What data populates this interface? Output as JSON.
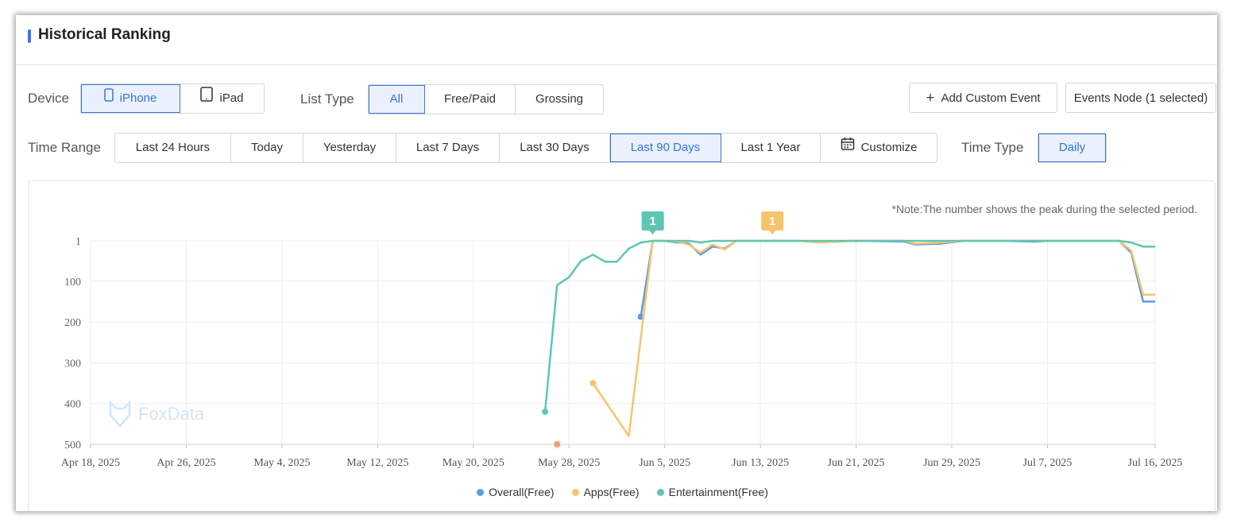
{
  "header": {
    "title": "Historical Ranking"
  },
  "device": {
    "label": "Device",
    "options": [
      {
        "label": "iPhone",
        "icon": "iphone-icon",
        "active": true
      },
      {
        "label": "iPad",
        "icon": "ipad-icon",
        "active": false
      }
    ]
  },
  "list_type": {
    "label": "List Type",
    "options": [
      {
        "label": "All",
        "active": true
      },
      {
        "label": "Free/Paid",
        "active": false
      },
      {
        "label": "Grossing",
        "active": false
      }
    ]
  },
  "actions": {
    "add_event_label": "Add Custom Event",
    "events_node_label": "Events Node (1 selected)"
  },
  "time_range": {
    "label": "Time Range",
    "options": [
      "Last 24 Hours",
      "Today",
      "Yesterday",
      "Last 7 Days",
      "Last 30 Days",
      "Last 90 Days",
      "Last 1 Year",
      "Customize"
    ],
    "active": "Last 90 Days"
  },
  "time_type": {
    "label": "Time Type",
    "option": "Daily"
  },
  "chart": {
    "note": "*Note:The number shows the peak during the selected period.",
    "watermark": "FoxData"
  },
  "colors": {
    "overall": "#5b9be8",
    "apps": "#f7c46c",
    "entertainment": "#5ec6b2",
    "accent": "#3b73d9"
  },
  "chart_data": {
    "type": "line",
    "y_reversed": true,
    "ylim": [
      1,
      500
    ],
    "yticks": [
      1,
      100,
      200,
      300,
      400,
      500
    ],
    "xlim": [
      "2025-04-18",
      "2025-07-16"
    ],
    "xticks": [
      "Apr 18, 2025",
      "Apr 26, 2025",
      "May 4, 2025",
      "May 12, 2025",
      "May 20, 2025",
      "May 28, 2025",
      "Jun 5, 2025",
      "Jun 13, 2025",
      "Jun 21, 2025",
      "Jun 29, 2025",
      "Jul 7, 2025",
      "Jul 16, 2025"
    ],
    "legend_position": "bottom",
    "series": [
      {
        "name": "Overall(Free)",
        "color": "#5b9be8",
        "points": [
          [
            "2025-06-03",
            187
          ],
          [
            "2025-06-04",
            1
          ],
          [
            "2025-06-05",
            1
          ],
          [
            "2025-06-06",
            5
          ],
          [
            "2025-06-07",
            7
          ],
          [
            "2025-06-08",
            35
          ],
          [
            "2025-06-09",
            15
          ],
          [
            "2025-06-10",
            20
          ],
          [
            "2025-06-11",
            1
          ],
          [
            "2025-06-12",
            1
          ],
          [
            "2025-06-13",
            1
          ],
          [
            "2025-06-14",
            1
          ],
          [
            "2025-06-16",
            1
          ],
          [
            "2025-06-18",
            3
          ],
          [
            "2025-06-21",
            1
          ],
          [
            "2025-06-25",
            3
          ],
          [
            "2025-06-26",
            10
          ],
          [
            "2025-06-28",
            8
          ],
          [
            "2025-06-30",
            1
          ],
          [
            "2025-07-03",
            1
          ],
          [
            "2025-07-06",
            3
          ],
          [
            "2025-07-07",
            1
          ],
          [
            "2025-07-13",
            1
          ],
          [
            "2025-07-14",
            30
          ],
          [
            "2025-07-15",
            150
          ],
          [
            "2025-07-16",
            150
          ]
        ]
      },
      {
        "name": "Apps(Free)",
        "color": "#f7c46c",
        "points": [
          [
            "2025-05-30",
            350
          ],
          [
            "2025-06-02",
            480
          ],
          [
            "2025-06-04",
            1
          ],
          [
            "2025-06-05",
            1
          ],
          [
            "2025-06-06",
            3
          ],
          [
            "2025-06-07",
            10
          ],
          [
            "2025-06-08",
            30
          ],
          [
            "2025-06-09",
            10
          ],
          [
            "2025-06-10",
            22
          ],
          [
            "2025-06-11",
            1
          ],
          [
            "2025-06-12",
            1
          ],
          [
            "2025-06-13",
            1
          ],
          [
            "2025-06-16",
            1
          ],
          [
            "2025-06-18",
            5
          ],
          [
            "2025-06-21",
            1
          ],
          [
            "2025-06-25",
            1
          ],
          [
            "2025-06-26",
            8
          ],
          [
            "2025-06-28",
            5
          ],
          [
            "2025-06-30",
            1
          ],
          [
            "2025-07-03",
            1
          ],
          [
            "2025-07-07",
            1
          ],
          [
            "2025-07-13",
            1
          ],
          [
            "2025-07-14",
            25
          ],
          [
            "2025-07-15",
            133
          ],
          [
            "2025-07-16",
            133
          ]
        ]
      },
      {
        "name": "Entertainment(Free)",
        "color": "#5ec6b2",
        "points": [
          [
            "2025-05-26",
            420
          ],
          [
            "2025-05-27",
            110
          ],
          [
            "2025-05-28",
            90
          ],
          [
            "2025-05-29",
            50
          ],
          [
            "2025-05-30",
            35
          ],
          [
            "2025-05-31",
            52
          ],
          [
            "2025-06-01",
            52
          ],
          [
            "2025-06-02",
            20
          ],
          [
            "2025-06-03",
            5
          ],
          [
            "2025-06-04",
            1
          ],
          [
            "2025-06-05",
            1
          ],
          [
            "2025-06-06",
            1
          ],
          [
            "2025-06-07",
            1
          ],
          [
            "2025-06-08",
            5
          ],
          [
            "2025-06-09",
            1
          ],
          [
            "2025-06-10",
            1
          ],
          [
            "2025-06-13",
            1
          ],
          [
            "2025-06-21",
            1
          ],
          [
            "2025-07-01",
            1
          ],
          [
            "2025-07-13",
            1
          ],
          [
            "2025-07-14",
            5
          ],
          [
            "2025-07-15",
            15
          ],
          [
            "2025-07-16",
            15
          ]
        ]
      }
    ],
    "isolated_markers": [
      {
        "date": "2025-05-27",
        "rank": 500,
        "color": "#f0a07a"
      }
    ],
    "peak_markers": [
      {
        "label": "1",
        "date": "2025-06-04",
        "color": "#5ec6b2"
      },
      {
        "label": "1",
        "date": "2025-06-14",
        "color": "#f7c46c"
      }
    ]
  }
}
